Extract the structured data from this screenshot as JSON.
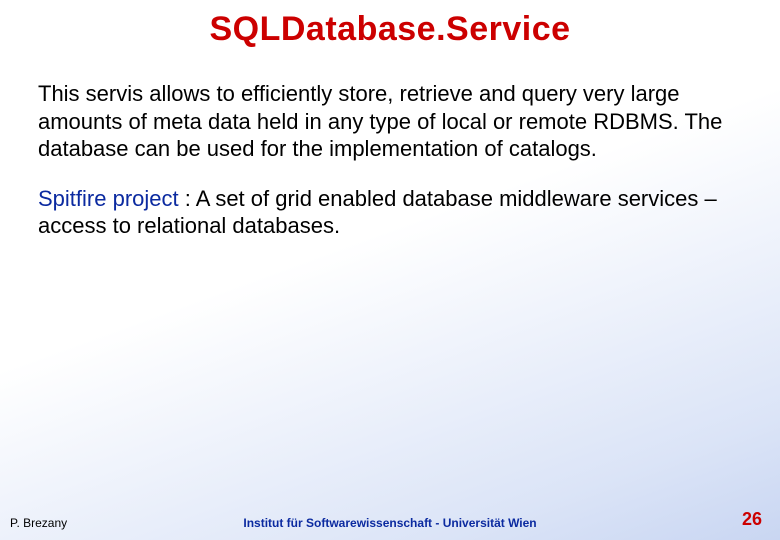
{
  "title": "SQLDatabase.Service",
  "paragraph1": "This servis allows to efficiently store, retrieve and query very large amounts of meta data held in any type of local or remote RDBMS. The database can be used for the implementation of catalogs.",
  "project_name": "Spitfire project",
  "paragraph2_rest": " : A set of grid enabled database middleware services – access to relational databases.",
  "footer": {
    "author": "P. Brezany",
    "institution": "Institut für Softwarewissenschaft - Universität Wien",
    "page": "26"
  }
}
